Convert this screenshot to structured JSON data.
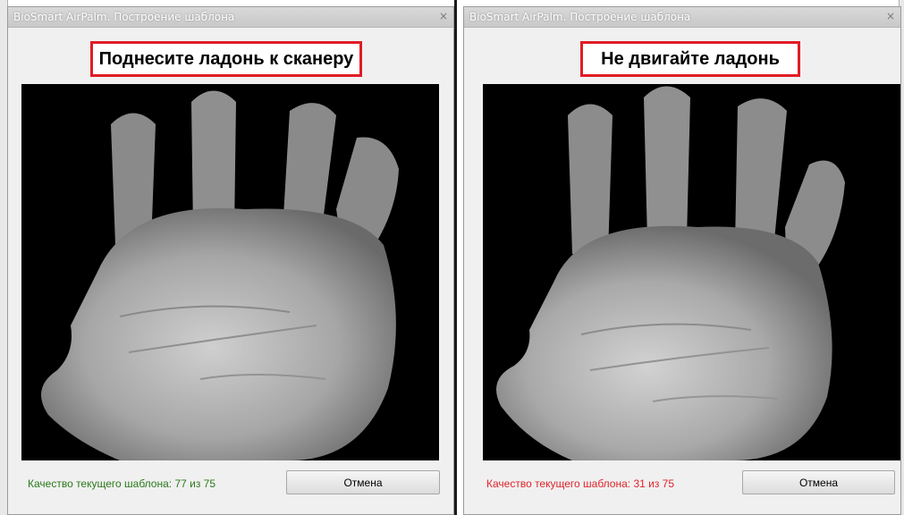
{
  "colors": {
    "highlight": "#e11c24",
    "quality_good": "#2a7a1a",
    "quality_bad": "#e0242c"
  },
  "windows": [
    {
      "title": "BioSmart AirPalm. Построение шаблона",
      "prompt": "Поднесите ладонь к сканеру",
      "quality_text": "Качество текущего шаблона: 77 из 75",
      "quality_state": "good",
      "cancel_label": "Отмена",
      "close_icon": "close-icon"
    },
    {
      "title": "BioSmart AirPalm. Построение шаблона",
      "prompt": "Не двигайте ладонь",
      "quality_text": "Качество текущего шаблона: 31 из 75",
      "quality_state": "bad",
      "cancel_label": "Отмена",
      "close_icon": "close-icon"
    }
  ]
}
